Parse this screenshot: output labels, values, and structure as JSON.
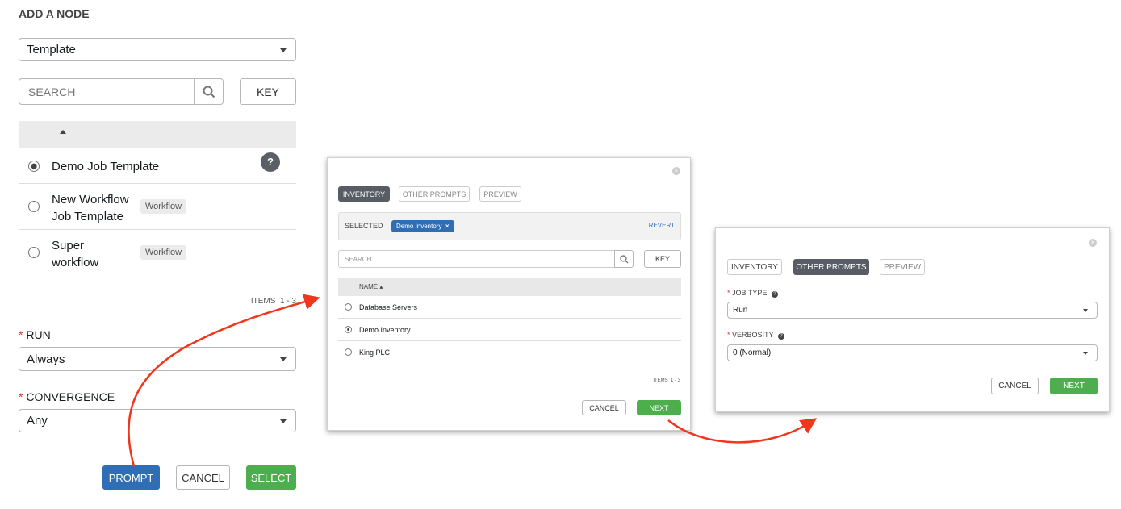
{
  "panel": {
    "title": "ADD A NODE",
    "type_select": "Template",
    "search_placeholder": "SEARCH",
    "key_label": "KEY",
    "rows": [
      {
        "name": "Demo Job Template",
        "selected": true,
        "badge": ""
      },
      {
        "name_line1": "New Workflow",
        "name_line2": "Job Template",
        "selected": false,
        "badge": "Workflow"
      },
      {
        "name_line1": "Super",
        "name_line2": "workflow",
        "selected": false,
        "badge": "Workflow"
      }
    ],
    "help_icon": "?",
    "items": "ITEMS  1 - 3",
    "run_label": "RUN",
    "run_value": "Always",
    "convergence_label": "CONVERGENCE",
    "convergence_value": "Any",
    "required_mark": "*",
    "buttons": {
      "prompt": "PROMPT",
      "cancel": "CANCEL",
      "select": "SELECT"
    }
  },
  "modal_inventory": {
    "tabs": [
      "INVENTORY",
      "OTHER PROMPTS",
      "PREVIEW"
    ],
    "selected_label": "SELECTED",
    "selected_chip": "Demo Inventory",
    "revert": "REVERT",
    "search_placeholder": "SEARCH",
    "key_label": "KEY",
    "column": "NAME",
    "rows": [
      {
        "name": "Database Servers",
        "selected": false
      },
      {
        "name": "Demo Inventory",
        "selected": true
      },
      {
        "name": "King PLC",
        "selected": false
      }
    ],
    "items": "ITEMS  1 - 3",
    "cancel": "CANCEL",
    "next": "NEXT"
  },
  "modal_prompts": {
    "tabs": [
      "INVENTORY",
      "OTHER PROMPTS",
      "PREVIEW"
    ],
    "job_type_label": "JOB TYPE",
    "job_type_value": "Run",
    "verbosity_label": "VERBOSITY",
    "verbosity_value": "0 (Normal)",
    "cancel": "CANCEL",
    "next": "NEXT"
  },
  "colors": {
    "primary": "#2f6db5",
    "success": "#4cae4c",
    "active_tab": "#585d65",
    "arrow": "#f0361c",
    "required": "#d9352a"
  }
}
